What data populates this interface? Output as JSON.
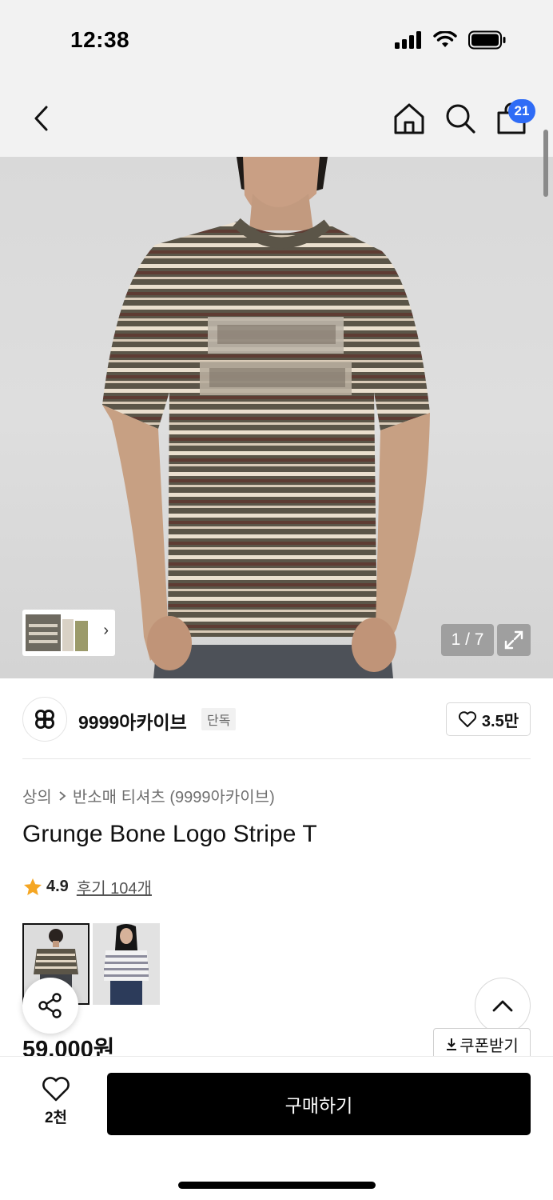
{
  "status_bar": {
    "time": "12:38"
  },
  "nav": {
    "back_icon": "chevron-left-icon",
    "home_icon": "home-icon",
    "search_icon": "search-icon",
    "cart_icon": "shopping-bag-icon",
    "cart_badge": "21"
  },
  "gallery": {
    "pager": "1 / 7",
    "expand_icon": "expand-icon",
    "thumb_strip_icon": "chevron-right-icon"
  },
  "brand": {
    "name": "9999아카이브",
    "tag": "단독",
    "likes": "3.5만"
  },
  "product": {
    "breadcrumb": [
      "상의",
      "반소매 티셔츠 (9999아카이브)"
    ],
    "title": "Grunge Bone Logo Stripe T",
    "rating": "4.9",
    "reviews_label": "후기 104개",
    "price": "59,000원",
    "coupon_label": "쿠폰받기"
  },
  "bottom_bar": {
    "wish_count": "2천",
    "buy_label": "구매하기"
  },
  "colors": {
    "accent_badge": "#2f6cf6",
    "star": "#f5a623",
    "buy_button": "#000000"
  }
}
